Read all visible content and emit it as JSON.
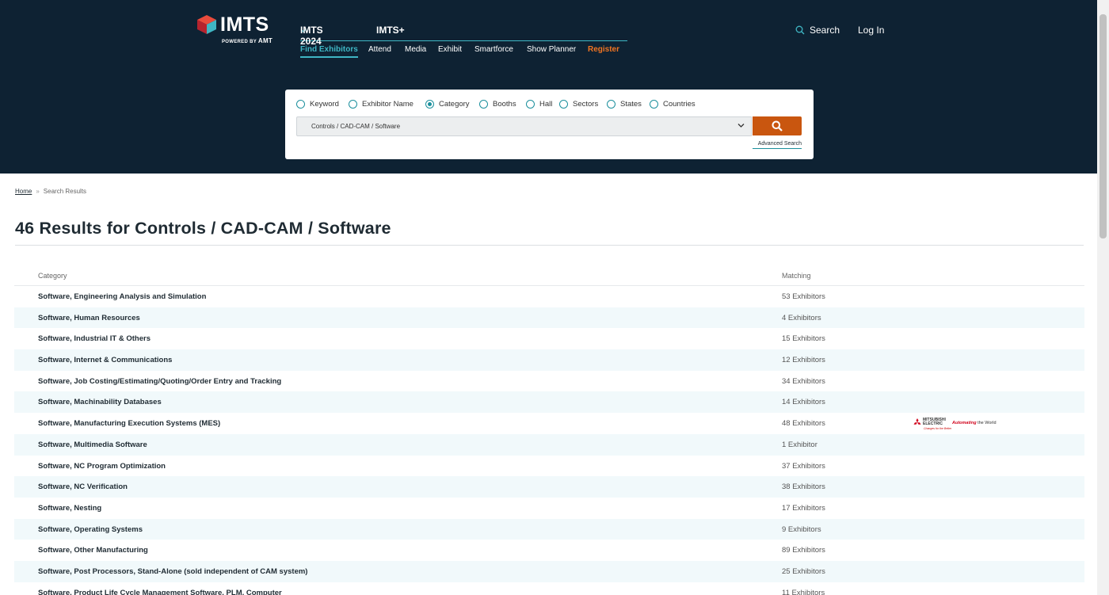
{
  "header": {
    "logo_text": "IMTS",
    "logo_powered_by": "POWERED BY",
    "logo_amt": "AMT",
    "top_nav": [
      {
        "label": "IMTS 2024"
      },
      {
        "label": "IMTS+"
      }
    ],
    "sub_nav": [
      {
        "label": "Find Exhibitors"
      },
      {
        "label": "Attend"
      },
      {
        "label": "Media"
      },
      {
        "label": "Exhibit"
      },
      {
        "label": "Smartforce"
      },
      {
        "label": "Show Planner"
      },
      {
        "label": "Register"
      }
    ],
    "search_label": "Search",
    "login_label": "Log In",
    "colors": {
      "background": "#0e2233",
      "accent": "#3fb6c4",
      "register": "#f07422"
    }
  },
  "search": {
    "options": [
      {
        "label": "Keyword",
        "checked": false
      },
      {
        "label": "Exhibitor Name",
        "checked": false
      },
      {
        "label": "Category",
        "checked": true
      },
      {
        "label": "Booths",
        "checked": false
      },
      {
        "label": "Hall",
        "checked": false
      },
      {
        "label": "Sectors",
        "checked": false
      },
      {
        "label": "States",
        "checked": false
      },
      {
        "label": "Countries",
        "checked": false
      }
    ],
    "selected_value": "Controls / CAD-CAM / Software",
    "advanced_label": "Advanced Search",
    "button_color": "#c9560f"
  },
  "breadcrumb": {
    "home": "Home",
    "separator": "»",
    "current": "Search Results"
  },
  "page_title": "46 Results for Controls / CAD-CAM / Software",
  "table": {
    "headers": {
      "category": "Category",
      "matching": "Matching"
    },
    "rows": [
      {
        "category": "Software, Engineering Analysis and Simulation",
        "matching": "53 Exhibitors"
      },
      {
        "category": "Software, Human Resources",
        "matching": "4 Exhibitors"
      },
      {
        "category": "Software, Industrial IT & Others",
        "matching": "15 Exhibitors"
      },
      {
        "category": "Software, Internet & Communications",
        "matching": "12 Exhibitors"
      },
      {
        "category": "Software, Job Costing/Estimating/Quoting/Order Entry and Tracking",
        "matching": "34 Exhibitors"
      },
      {
        "category": "Software, Machinability Databases",
        "matching": "14 Exhibitors"
      },
      {
        "category": "Software, Manufacturing Execution Systems (MES)",
        "matching": "48 Exhibitors",
        "sponsor": true
      },
      {
        "category": "Software, Multimedia Software",
        "matching": "1 Exhibitor"
      },
      {
        "category": "Software, NC Program Optimization",
        "matching": "37 Exhibitors"
      },
      {
        "category": "Software, NC Verification",
        "matching": "38 Exhibitors"
      },
      {
        "category": "Software, Nesting",
        "matching": "17 Exhibitors"
      },
      {
        "category": "Software, Operating Systems",
        "matching": "9 Exhibitors"
      },
      {
        "category": "Software, Other Manufacturing",
        "matching": "89 Exhibitors"
      },
      {
        "category": "Software, Post Processors, Stand-Alone (sold independent of CAM system)",
        "matching": "25 Exhibitors"
      },
      {
        "category": "Software, Product Life Cycle Management Software, PLM, Computer",
        "matching": "11 Exhibitors"
      }
    ]
  },
  "sponsor": {
    "brand_line1": "MITSUBISHI",
    "brand_line2": "ELECTRIC",
    "tagline": "Changes for the Better",
    "slogan_highlight": "Automating",
    "slogan_rest": " the World"
  }
}
